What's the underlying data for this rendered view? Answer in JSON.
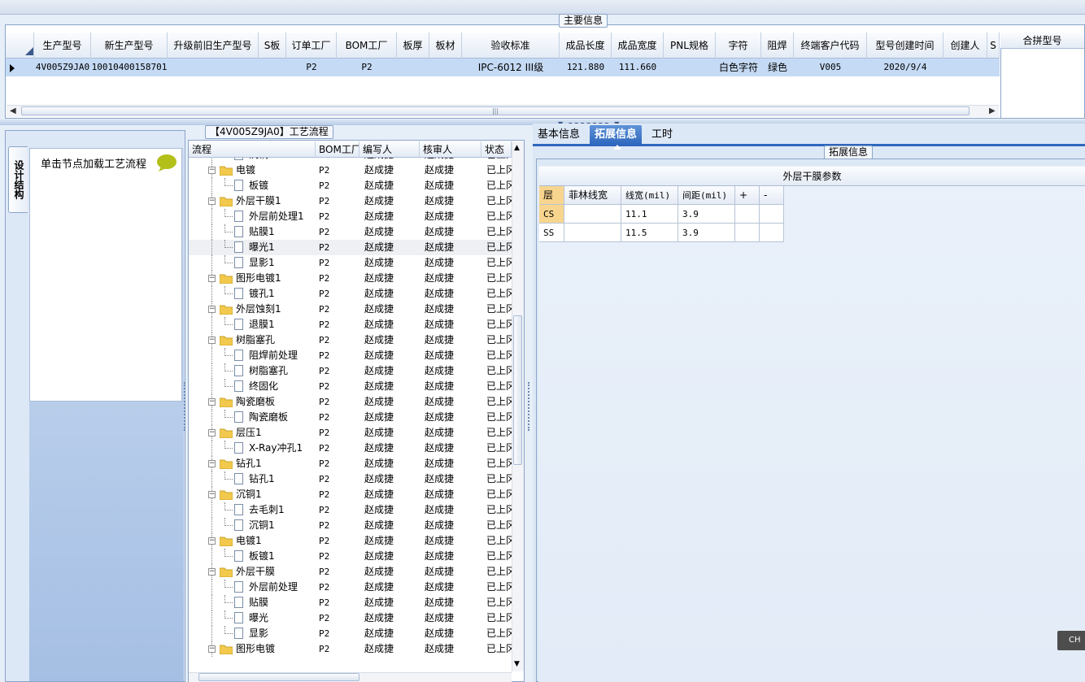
{
  "main_info": {
    "group_title": "主要信息",
    "columns": [
      "生产型号",
      "新生产型号",
      "升级前旧生产型号",
      "S板",
      "订单工厂",
      "BOM工厂",
      "板厚",
      "板材",
      "验收标准",
      "成品长度",
      "成品宽度",
      "PNL规格",
      "字符",
      "阻焊",
      "终端客户代码",
      "型号创建时间",
      "创建人",
      "S"
    ],
    "row": [
      "4V005Z9JA0",
      "10010400158701",
      "",
      "",
      "P2",
      "P2",
      "",
      "",
      "IPC-6012 III级",
      "121.880",
      "111.660",
      "",
      "白色字符",
      "绿色",
      "V005",
      "2020/9/4",
      "",
      ""
    ],
    "scroll_thumb_grip": "|||",
    "hejin_header": "合拼型号"
  },
  "process": {
    "group_title": "【4V005Z9JA0】工艺流程",
    "side_tab": "设计结构",
    "hint": "单击节点加载工艺流程",
    "columns": [
      "流程",
      "BOM工厂",
      "编写人",
      "核审人",
      "状态"
    ],
    "rows": [
      {
        "lvl": 2,
        "name": "沉铜",
        "bom": "P2",
        "writer": "赵成捷",
        "checker": "赵成捷",
        "status": "已上冈"
      },
      {
        "lvl": 1,
        "name": "电镀",
        "bom": "P2",
        "writer": "赵成捷",
        "checker": "赵成捷",
        "status": "已上冈"
      },
      {
        "lvl": 2,
        "name": "板镀",
        "bom": "P2",
        "writer": "赵成捷",
        "checker": "赵成捷",
        "status": "已上冈"
      },
      {
        "lvl": 1,
        "name": "外层干膜1",
        "bom": "P2",
        "writer": "赵成捷",
        "checker": "赵成捷",
        "status": "已上冈"
      },
      {
        "lvl": 2,
        "name": "外层前处理1",
        "bom": "P2",
        "writer": "赵成捷",
        "checker": "赵成捷",
        "status": "已上冈"
      },
      {
        "lvl": 2,
        "name": "贴膜1",
        "bom": "P2",
        "writer": "赵成捷",
        "checker": "赵成捷",
        "status": "已上冈"
      },
      {
        "lvl": 2,
        "name": "曝光1",
        "bom": "P2",
        "writer": "赵成捷",
        "checker": "赵成捷",
        "status": "已上冈",
        "hover": true
      },
      {
        "lvl": 2,
        "name": "显影1",
        "bom": "P2",
        "writer": "赵成捷",
        "checker": "赵成捷",
        "status": "已上冈"
      },
      {
        "lvl": 1,
        "name": "图形电镀1",
        "bom": "P2",
        "writer": "赵成捷",
        "checker": "赵成捷",
        "status": "已上冈"
      },
      {
        "lvl": 2,
        "name": "镀孔1",
        "bom": "P2",
        "writer": "赵成捷",
        "checker": "赵成捷",
        "status": "已上冈"
      },
      {
        "lvl": 1,
        "name": "外层蚀刻1",
        "bom": "P2",
        "writer": "赵成捷",
        "checker": "赵成捷",
        "status": "已上冈"
      },
      {
        "lvl": 2,
        "name": "退膜1",
        "bom": "P2",
        "writer": "赵成捷",
        "checker": "赵成捷",
        "status": "已上冈"
      },
      {
        "lvl": 1,
        "name": "树脂塞孔",
        "bom": "P2",
        "writer": "赵成捷",
        "checker": "赵成捷",
        "status": "已上冈"
      },
      {
        "lvl": 2,
        "name": "阻焊前处理",
        "bom": "P2",
        "writer": "赵成捷",
        "checker": "赵成捷",
        "status": "已上冈"
      },
      {
        "lvl": 2,
        "name": "树脂塞孔",
        "bom": "P2",
        "writer": "赵成捷",
        "checker": "赵成捷",
        "status": "已上冈"
      },
      {
        "lvl": 2,
        "name": "终固化",
        "bom": "P2",
        "writer": "赵成捷",
        "checker": "赵成捷",
        "status": "已上冈"
      },
      {
        "lvl": 1,
        "name": "陶瓷磨板",
        "bom": "P2",
        "writer": "赵成捷",
        "checker": "赵成捷",
        "status": "已上冈"
      },
      {
        "lvl": 2,
        "name": "陶瓷磨板",
        "bom": "P2",
        "writer": "赵成捷",
        "checker": "赵成捷",
        "status": "已上冈"
      },
      {
        "lvl": 1,
        "name": "层压1",
        "bom": "P2",
        "writer": "赵成捷",
        "checker": "赵成捷",
        "status": "已上冈"
      },
      {
        "lvl": 2,
        "name": "X-Ray冲孔1",
        "bom": "P2",
        "writer": "赵成捷",
        "checker": "赵成捷",
        "status": "已上冈"
      },
      {
        "lvl": 1,
        "name": "钻孔1",
        "bom": "P2",
        "writer": "赵成捷",
        "checker": "赵成捷",
        "status": "已上冈"
      },
      {
        "lvl": 2,
        "name": "钻孔1",
        "bom": "P2",
        "writer": "赵成捷",
        "checker": "赵成捷",
        "status": "已上冈"
      },
      {
        "lvl": 1,
        "name": "沉铜1",
        "bom": "P2",
        "writer": "赵成捷",
        "checker": "赵成捷",
        "status": "已上冈"
      },
      {
        "lvl": 2,
        "name": "去毛刺1",
        "bom": "P2",
        "writer": "赵成捷",
        "checker": "赵成捷",
        "status": "已上冈"
      },
      {
        "lvl": 2,
        "name": "沉铜1",
        "bom": "P2",
        "writer": "赵成捷",
        "checker": "赵成捷",
        "status": "已上冈"
      },
      {
        "lvl": 1,
        "name": "电镀1",
        "bom": "P2",
        "writer": "赵成捷",
        "checker": "赵成捷",
        "status": "已上冈"
      },
      {
        "lvl": 2,
        "name": "板镀1",
        "bom": "P2",
        "writer": "赵成捷",
        "checker": "赵成捷",
        "status": "已上冈"
      },
      {
        "lvl": 1,
        "name": "外层干膜",
        "bom": "P2",
        "writer": "赵成捷",
        "checker": "赵成捷",
        "status": "已上冈"
      },
      {
        "lvl": 2,
        "name": "外层前处理",
        "bom": "P2",
        "writer": "赵成捷",
        "checker": "赵成捷",
        "status": "已上冈"
      },
      {
        "lvl": 2,
        "name": "贴膜",
        "bom": "P2",
        "writer": "赵成捷",
        "checker": "赵成捷",
        "status": "已上冈"
      },
      {
        "lvl": 2,
        "name": "曝光",
        "bom": "P2",
        "writer": "赵成捷",
        "checker": "赵成捷",
        "status": "已上冈"
      },
      {
        "lvl": 2,
        "name": "显影",
        "bom": "P2",
        "writer": "赵成捷",
        "checker": "赵成捷",
        "status": "已上冈"
      },
      {
        "lvl": 1,
        "name": "图形电镀",
        "bom": "P2",
        "writer": "赵成捷",
        "checker": "赵成捷",
        "status": "已上冈"
      }
    ]
  },
  "detail": {
    "tabs": [
      "基本信息",
      "拓展信息",
      "工时"
    ],
    "active_tab": "拓展信息",
    "group_title": "拓展信息",
    "params_title": "外层干膜参数",
    "param_columns": [
      "层",
      "菲林线宽",
      "线宽(mil)",
      "间距(mil)",
      "+",
      "-"
    ],
    "param_rows": [
      [
        "CS",
        "",
        "11.1",
        "3.9",
        "",
        ""
      ],
      [
        "SS",
        "",
        "11.5",
        "3.9",
        "",
        ""
      ]
    ]
  },
  "corner_label": "CH",
  "colors": {
    "accent": "#2e67bd",
    "selection": "#c5daf4",
    "folder": "#f2c94c",
    "highlight": "#f8d58f"
  }
}
